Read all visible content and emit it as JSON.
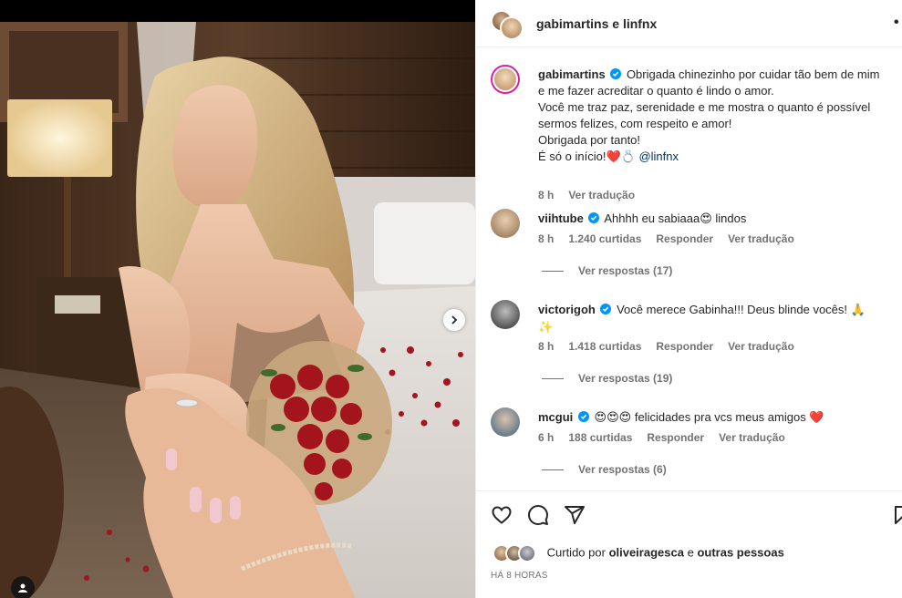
{
  "header": {
    "user1": "gabimartins",
    "connector": "e",
    "user2": "linfnx",
    "more_icon": "more-dots-icon"
  },
  "caption": {
    "username": "gabimartins",
    "lines": [
      "Obrigada chinezinho por cuidar tão bem de mim",
      "e me fazer acreditar o quanto é lindo o amor.",
      "Você me traz paz, serenidade e me mostra o quanto é possível",
      "sermos felizes, com respeito e amor!",
      "Obrigada por tanto!",
      "É só o início!"
    ],
    "emojis": "❤️💍",
    "mention": "@linfnx",
    "time": "8 h",
    "translate": "Ver tradução"
  },
  "comments": [
    {
      "username": "viihtube",
      "text": "Ahhhh eu sabiaaa",
      "emoji_after": "😍",
      "text_after": " lindos",
      "time": "8 h",
      "likes": "1.240 curtidas",
      "reply": "Responder",
      "translate": "Ver tradução",
      "view_replies": "Ver respostas (17)"
    },
    {
      "username": "victorigoh",
      "text": "Você merece Gabinha!!! Deus blinde vocês!",
      "emoji_after": "🙏",
      "line2_emoji": "✨",
      "time": "8 h",
      "likes": "1.418 curtidas",
      "reply": "Responder",
      "translate": "Ver tradução",
      "view_replies": "Ver respostas (19)"
    },
    {
      "username": "mcgui",
      "emoji_before": "😍😍😍",
      "text": "felicidades pra vcs meus amigos",
      "emoji_after": "❤️",
      "time": "6 h",
      "likes": "188 curtidas",
      "reply": "Responder",
      "translate": "Ver tradução",
      "view_replies": "Ver respostas (6)"
    }
  ],
  "actions": {
    "like_icon": "heart-icon",
    "comment_icon": "comment-icon",
    "share_icon": "share-icon",
    "save_icon": "bookmark-icon"
  },
  "liked_by": {
    "prefix": "Curtido por",
    "user": "oliveiragesca",
    "connector": "e",
    "others": "outras pessoas"
  },
  "timestamp": "HÁ 8 HORAS",
  "colors": {
    "verified": "#0095f6",
    "heart": "#ed4956",
    "meta_gray": "#737373",
    "mention": "#00376b"
  }
}
